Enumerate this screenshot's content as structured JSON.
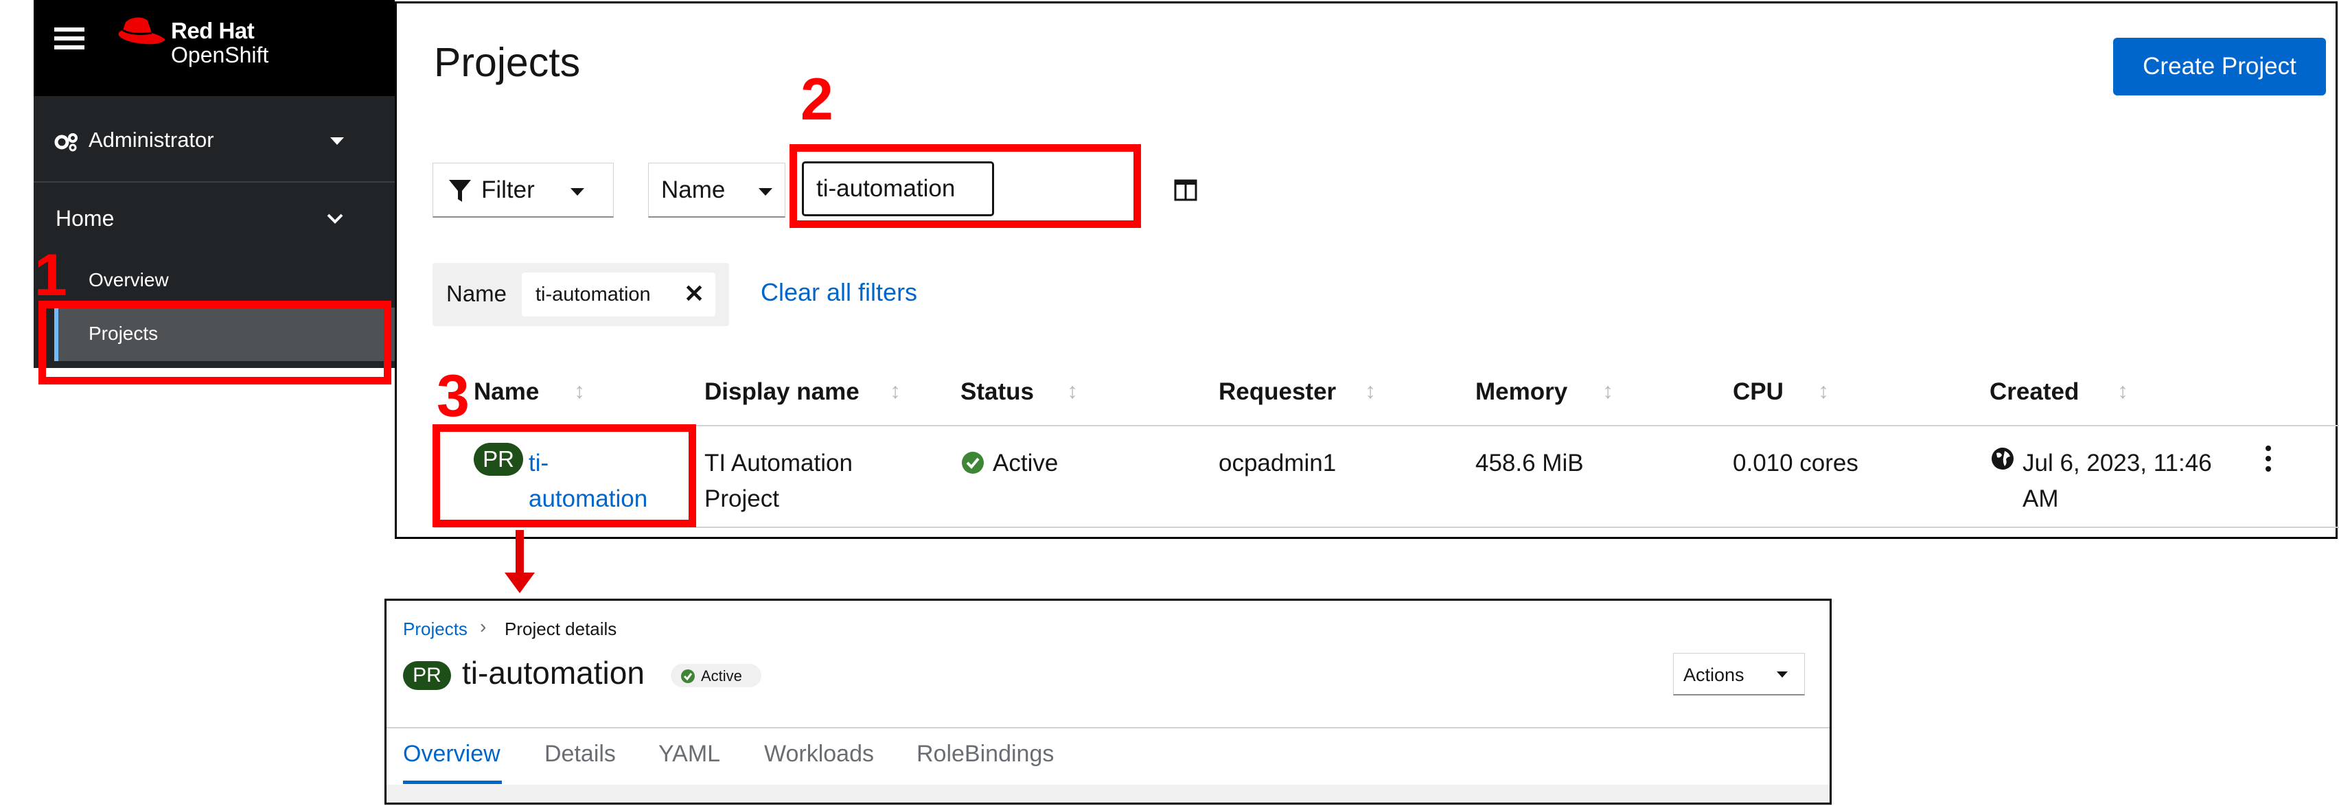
{
  "sidebar": {
    "brand_line1": "Red Hat",
    "brand_line2": "OpenShift",
    "perspective": "Administrator",
    "section": "Home",
    "items": [
      {
        "label": "Overview"
      },
      {
        "label": "Projects"
      }
    ]
  },
  "projects_page": {
    "title": "Projects",
    "create_button": "Create Project",
    "filter_label": "Filter",
    "name_dropdown": "Name",
    "search_value": "ti-automation",
    "chip_category": "Name",
    "chip_value": "ti-automation",
    "clear_filters": "Clear all filters",
    "columns": [
      "Name",
      "Display name",
      "Status",
      "Requester",
      "Memory",
      "CPU",
      "Created"
    ],
    "rows": [
      {
        "badge": "PR",
        "name_line1": "ti-",
        "name_line2": "automation",
        "display_line1": "TI Automation",
        "display_line2": "Project",
        "status": "Active",
        "requester": "ocpadmin1",
        "memory": "458.6 MiB",
        "cpu": "0.010 cores",
        "created_line1": "Jul 6, 2023, 11:46",
        "created_line2": "AM"
      }
    ]
  },
  "details_page": {
    "breadcrumb_link": "Projects",
    "breadcrumb_current": "Project details",
    "badge": "PR",
    "title": "ti-automation",
    "status": "Active",
    "actions": "Actions",
    "tabs": [
      "Overview",
      "Details",
      "YAML",
      "Workloads",
      "RoleBindings"
    ]
  },
  "callouts": {
    "step1": "1",
    "step2": "2",
    "step3": "3"
  },
  "colors": {
    "primary_blue": "#0066cc",
    "callout_red": "#ff0000",
    "badge_green": "#1e4f18",
    "sidebar_bg": "#212427",
    "success_green": "#3e8635"
  },
  "icons": [
    "hamburger-icon",
    "redhat-hat-icon",
    "cogs-icon",
    "filter-icon",
    "columns-icon",
    "close-icon",
    "sort-icon",
    "check-circle-icon",
    "globe-icon",
    "kebab-icon",
    "chevron-right-icon",
    "caret-down-icon"
  ]
}
